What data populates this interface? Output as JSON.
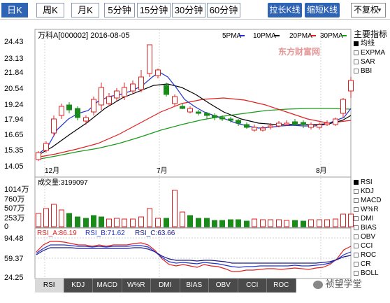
{
  "toolbar": {
    "tabs": [
      "日K",
      "周K",
      "月K",
      "5分钟",
      "15分钟",
      "30分钟",
      "60分钟"
    ],
    "active_tab": 0,
    "stretch_label": "拉长K线",
    "shrink_label": "缩短K线",
    "adjust_select": "不复权"
  },
  "chart": {
    "title": "万科A[000002] 2016-08-05",
    "legend": [
      {
        "label": "5PMA",
        "color": "#2233cc"
      },
      {
        "label": "10PMA",
        "color": "#000000"
      },
      {
        "label": "20PMA",
        "color": "#e02020"
      },
      {
        "label": "30PMA",
        "color": "#1a9a1a"
      }
    ],
    "y_ticks": [
      "24.43",
      "23.13",
      "21.84",
      "20.54",
      "19.24",
      "17.94",
      "16.65",
      "15.35",
      "14.05"
    ],
    "x_labels": [
      "12月",
      "7月",
      "8月"
    ]
  },
  "volume": {
    "label": "成交量:3199097",
    "y_ticks": [
      "1014万",
      "760万",
      "507万",
      "253万",
      "0"
    ]
  },
  "rsi": {
    "a_label": "RSI_A:86.19",
    "b_label": "RSI_B:71.62",
    "c_label": "RSI_C:63.66",
    "y_ticks": [
      "94.48",
      "59.37",
      "24.25"
    ]
  },
  "side": {
    "heading": "主要指标",
    "main_items": [
      "均线",
      "EXPMA",
      "SAR",
      "BBI"
    ],
    "main_checked": 0,
    "sub_items": [
      "RSI",
      "KDJ",
      "MACD",
      "W%R",
      "DMI",
      "BIAS",
      "OBV",
      "CCI",
      "ROC",
      "CR",
      "BOLL"
    ],
    "sub_checked": 0
  },
  "bottom_tabs": [
    "RSI",
    "KDJ",
    "MACD",
    "W%R",
    "DMI",
    "BIAS",
    "OBV",
    "CCI",
    "ROC"
  ],
  "bottom_active": 0,
  "watermark_text": "东方财富网",
  "wechat_text": "祯望学堂",
  "colors": {
    "up": "#e02020",
    "down": "#1a8a1a",
    "ma5": "#2233cc",
    "ma10": "#000000",
    "ma20": "#e02020",
    "ma30": "#1a9a1a",
    "rsi_a": "#e02020",
    "rsi_b": "#2233cc",
    "rsi_c": "#1a1a8a"
  }
}
